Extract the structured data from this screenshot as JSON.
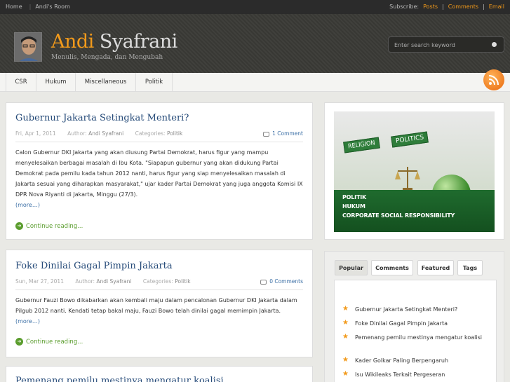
{
  "topbar": {
    "nav": [
      "Home",
      "Andi's Room"
    ],
    "subscribe_label": "Subscribe:",
    "posts": "Posts",
    "comments": "Comments",
    "email": "Email",
    "sep": "|"
  },
  "header": {
    "title_first": "Andi",
    "title_last": "Syafrani",
    "tagline": "Menulis, Mengada, dan Mengubah",
    "search_placeholder": "Enter search keyword"
  },
  "menu": [
    "CSR",
    "Hukum",
    "Miscellaneous",
    "Politik"
  ],
  "meta_labels": {
    "author": "Author:",
    "categories": "Categories:"
  },
  "posts": [
    {
      "title": "Gubernur Jakarta Setingkat Menteri?",
      "date": "Fri, Apr 1, 2011",
      "author": "Andi Syafrani",
      "category": "Politik",
      "comments": "1 Comment",
      "excerpt": "Calon Gubernur DKI Jakarta yang akan diusung Partai Demokrat, harus figur yang mampu menyelesaikan berbagai masalah di Ibu Kota. \"Siapapun gubernur yang akan didukung Partai Demokrat pada pemilu kada tahun 2012 nanti, harus figur yang siap menyelesaikan masalah di Jakarta sesuai yang diharapkan masyarakat,\" ujar kader Partai Demokrat yang juga anggota Komisi IX DPR Nova Riyanti di Jakarta, Minggu (27/3).",
      "more": "(more…)",
      "continue": "Continue reading..."
    },
    {
      "title": "Foke Dinilai Gagal Pimpin Jakarta",
      "date": "Sun, Mar 27, 2011",
      "author": "Andi Syafrani",
      "category": "Politik",
      "comments": "0 Comments",
      "excerpt": "Gubernur Fauzi Bowo dikabarkan akan kembali maju dalam pencalonan Gubernur DKI Jakarta dalam Pilgub 2012 nanti. Kendati tetap bakal maju, Fauzi Bowo telah dinilai gagal memimpin Jakarta.",
      "more": "(more…)",
      "continue": "Continue reading..."
    },
    {
      "title": "Pemenang pemilu mestinya mengatur koalisi"
    }
  ],
  "banner": {
    "sign_left": "RELIGION",
    "sign_right": "POLITICS",
    "lines": [
      "POLITIK",
      "HUKUM",
      "CORPORATE SOCIAL RESPONSIBILITY"
    ]
  },
  "tabs": [
    "Popular",
    "Comments",
    "Featured",
    "Tags"
  ],
  "popular": [
    "Gubernur Jakarta Setingkat Menteri?",
    "Foke Dinilai Gagal Pimpin Jakarta",
    "Pemenang pemilu mestinya mengatur koalisi",
    "Kader Golkar Paling Berpengaruh",
    "Isu Wikileaks Terkait Pergeseran"
  ],
  "colors": {
    "accent": "#f29a1b",
    "link": "#254a78",
    "continue": "#5b9d2e"
  }
}
